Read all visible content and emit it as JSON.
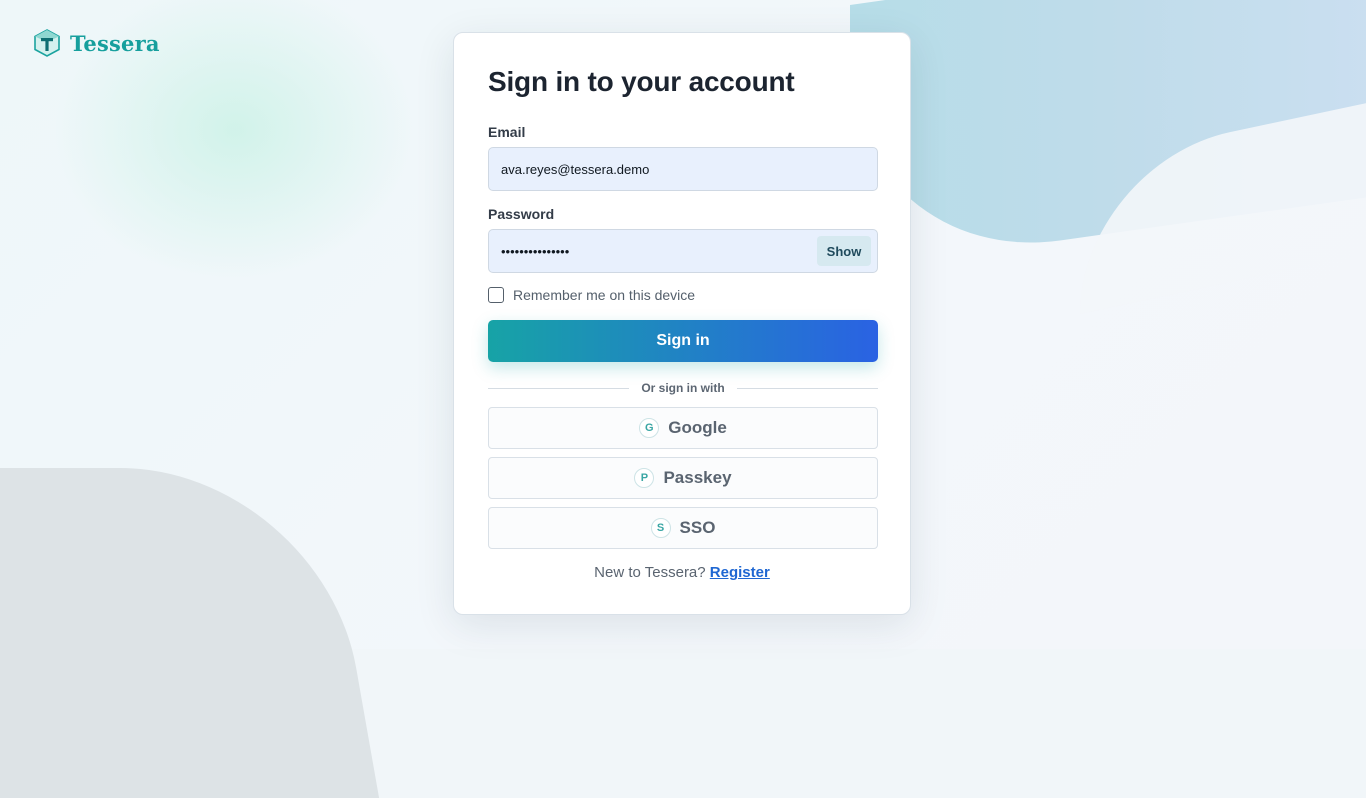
{
  "brand": {
    "name": "Tessera",
    "color": "#169f9d"
  },
  "signin": {
    "title": "Sign in to your account",
    "email_label": "Email",
    "email_value": "ava.reyes@tessera.demo",
    "password_label": "Password",
    "password_value": "•••••••••••••••",
    "show_label": "Show",
    "remember_label": "Remember me on this device",
    "remember_checked": false,
    "submit_label": "Sign in",
    "divider_text": "Or sign in with",
    "providers": [
      {
        "icon": "G",
        "label": "Google",
        "icon_name": "google-icon"
      },
      {
        "icon": "P",
        "label": "Passkey",
        "icon_name": "passkey-icon"
      },
      {
        "icon": "S",
        "label": "SSO",
        "icon_name": "sso-icon"
      }
    ],
    "footer_text": "New to Tessera?",
    "register_label": "Register"
  },
  "colors": {
    "gradient_start": "#17a3a6",
    "gradient_end": "#2a62e3",
    "link": "#1f67d2",
    "input_bg": "#e8f0fd"
  }
}
